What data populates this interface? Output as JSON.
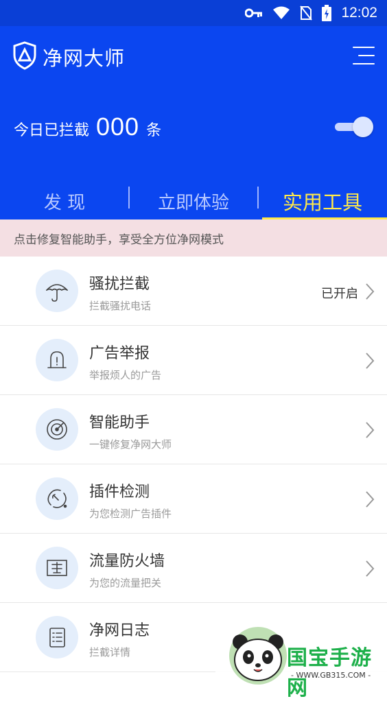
{
  "status_bar": {
    "time": "12:02"
  },
  "header": {
    "app_title": "净网大师",
    "count_prefix": "今日已拦截",
    "count_value": "000",
    "count_suffix": "条",
    "toggle_on": true
  },
  "tabs": [
    {
      "label": "发 现",
      "active": false
    },
    {
      "label": "立即体验",
      "active": false
    },
    {
      "label": "实用工具",
      "active": true
    }
  ],
  "notice": "点击修复智能助手，享受全方位净网模式",
  "tools": [
    {
      "title": "骚扰拦截",
      "subtitle": "拦截骚扰电话",
      "status": "已开启",
      "icon": "umbrella-icon"
    },
    {
      "title": "广告举报",
      "subtitle": "举报烦人的广告",
      "status": "",
      "icon": "alarm-icon"
    },
    {
      "title": "智能助手",
      "subtitle": "一键修复净网大师",
      "status": "",
      "icon": "radar-icon"
    },
    {
      "title": "插件检测",
      "subtitle": "为您检测广告插件",
      "status": "",
      "icon": "plugin-wrench-icon"
    },
    {
      "title": "流量防火墙",
      "subtitle": "为您的流量把关",
      "status": "",
      "icon": "firewall-icon"
    },
    {
      "title": "净网日志",
      "subtitle": "拦截详情",
      "status": "",
      "icon": "log-icon"
    }
  ],
  "watermark": {
    "brand": "国宝手游网",
    "url": "- WWW.GB315.COM -"
  },
  "colors": {
    "header_bg": "#0b46f0",
    "active_tab": "#ffe94a",
    "notice_bg": "#f4dfe3"
  }
}
